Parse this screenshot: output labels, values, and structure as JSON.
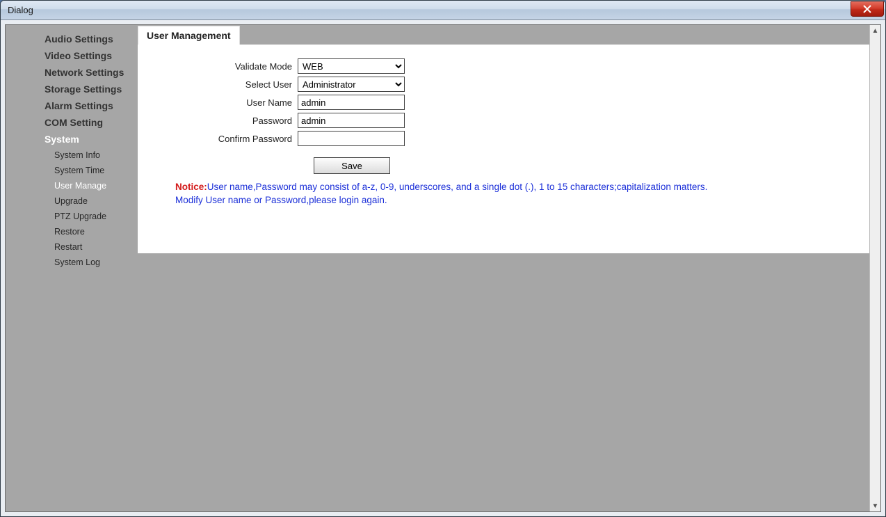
{
  "window": {
    "title": "Dialog"
  },
  "sidebar": {
    "main": [
      {
        "label": "Audio Settings",
        "active": false
      },
      {
        "label": "Video Settings",
        "active": false
      },
      {
        "label": "Network Settings",
        "active": false
      },
      {
        "label": "Storage Settings",
        "active": false
      },
      {
        "label": "Alarm Settings",
        "active": false
      },
      {
        "label": "COM Setting",
        "active": false
      },
      {
        "label": "System",
        "active": true
      }
    ],
    "sub": [
      {
        "label": "System Info",
        "active": false
      },
      {
        "label": "System Time",
        "active": false
      },
      {
        "label": "User Manage",
        "active": true
      },
      {
        "label": "Upgrade",
        "active": false
      },
      {
        "label": "PTZ Upgrade",
        "active": false
      },
      {
        "label": "Restore",
        "active": false
      },
      {
        "label": "Restart",
        "active": false
      },
      {
        "label": "System Log",
        "active": false
      }
    ]
  },
  "tab": {
    "label": "User Management"
  },
  "form": {
    "validate_mode": {
      "label": "Validate Mode",
      "value": "WEB"
    },
    "select_user": {
      "label": "Select User",
      "value": "Administrator"
    },
    "user_name": {
      "label": "User Name",
      "value": "admin"
    },
    "password": {
      "label": "Password",
      "value": "admin"
    },
    "confirm": {
      "label": "Confirm Password",
      "value": ""
    },
    "save_label": "Save"
  },
  "notice": {
    "label": "Notice:",
    "line1": "User name,Password may consist of a-z, 0-9, underscores, and a single dot (.), 1 to 15 characters;capitalization matters.",
    "line2": "Modify User name or Password,please login again."
  }
}
